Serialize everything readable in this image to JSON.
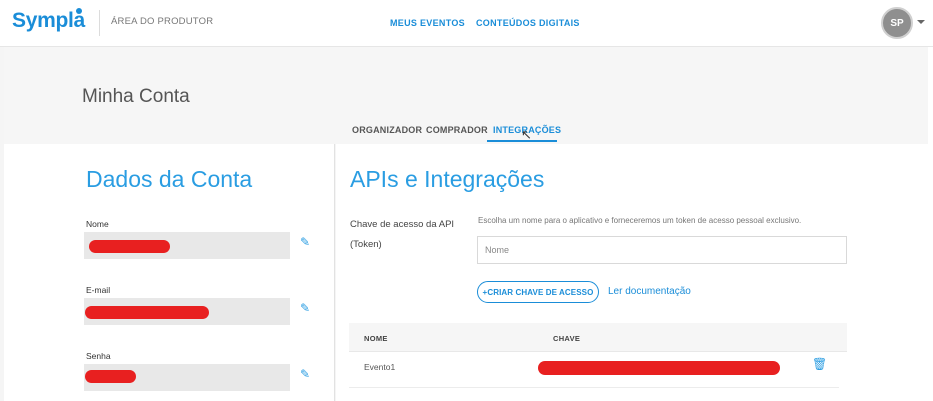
{
  "topbar": {
    "logo": "Sympla",
    "area": "ÁREA DO PRODUTOR",
    "nav": [
      "MEUS EVENTOS",
      "CONTEÚDOS DIGITAIS"
    ],
    "avatar_initials": "SP"
  },
  "header": {
    "title": "Minha Conta",
    "tabs": [
      "ORGANIZADOR",
      "COMPRADOR",
      "INTEGRAÇÕES"
    ],
    "active_tab": "INTEGRAÇÕES"
  },
  "account": {
    "heading": "Dados da Conta",
    "fields": [
      {
        "label": "Nome",
        "value": "[redacted]"
      },
      {
        "label": "E-mail",
        "value": "[redacted]"
      },
      {
        "label": "Senha",
        "value": "[redacted]"
      }
    ]
  },
  "integrations": {
    "heading": "APIs e Integrações",
    "token_label": "Chave de acesso da API (Token)",
    "help_text": "Escolha um nome para o aplicativo e forneceremos um token de acesso pessoal exclusivo.",
    "name_placeholder": "Nome",
    "create_button": "+CRIAR CHAVE DE ACESSO",
    "doc_link": "Ler documentação",
    "table": {
      "columns": [
        "NOME",
        "CHAVE"
      ],
      "rows": [
        {
          "nome": "Evento1",
          "chave": "[redacted]"
        }
      ]
    }
  },
  "colors": {
    "accent": "#1a8dd8",
    "heading": "#2a9de2",
    "redaction": "#e82020"
  },
  "icons": [
    "pencil-icon",
    "trash-icon",
    "caret-down-icon",
    "cursor-icon"
  ]
}
